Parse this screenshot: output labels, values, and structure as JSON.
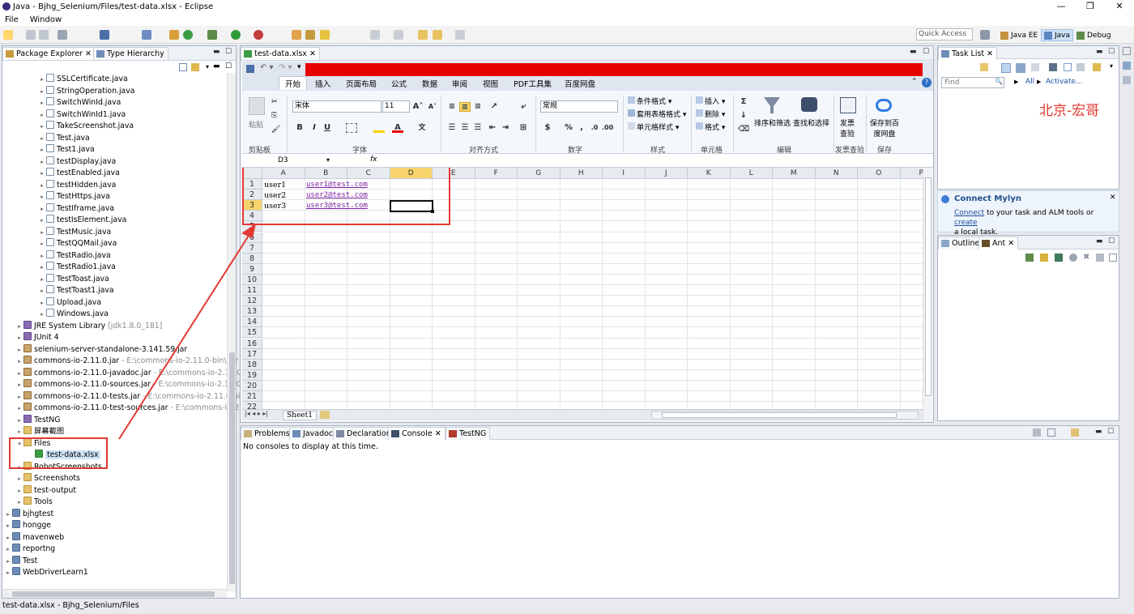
{
  "window": {
    "title": "Java - Bjhg_Selenium/Files/test-data.xlsx - Eclipse",
    "controls": [
      "—",
      "❐",
      "✕"
    ]
  },
  "menu": [
    "File",
    "Window"
  ],
  "toolbar": {
    "quick_access": "Quick Access",
    "perspectives": [
      "Java EE",
      "Java",
      "Debug"
    ]
  },
  "package_explorer": {
    "tabs": [
      "Package Explorer",
      "Type Hierarchy"
    ],
    "java_files": [
      "SSLCertificate.java",
      "StringOperation.java",
      "SwitchWinId.java",
      "SwitchWinId1.java",
      "TakeScreenshot.java",
      "Test.java",
      "Test1.java",
      "testDisplay.java",
      "testEnabled.java",
      "testHidden.java",
      "TestHttps.java",
      "TestIframe.java",
      "testIsElement.java",
      "TestMusic.java",
      "TestQQMail.java",
      "TestRadio.java",
      "TestRadio1.java",
      "TestToast.java",
      "TestToast1.java",
      "Upload.java",
      "Windows.java"
    ],
    "libs": [
      {
        "name": "JRE System Library",
        "extra": "[jdk1.8.0_181]"
      },
      {
        "name": "JUnit 4",
        "extra": ""
      },
      {
        "name": "selenium-server-standalone-3.141.59.jar",
        "extra": ""
      },
      {
        "name": "commons-io-2.11.0.jar",
        "extra": "- E:\\commons-io-2.11.0-bin\\cor"
      },
      {
        "name": "commons-io-2.11.0-javadoc.jar",
        "extra": "- E:\\commons-io-2.11.0"
      },
      {
        "name": "commons-io-2.11.0-sources.jar",
        "extra": "- E:\\commons-io-2.11.0"
      },
      {
        "name": "commons-io-2.11.0-tests.jar",
        "extra": "- E:\\commons-io-2.11.0-bi"
      },
      {
        "name": "commons-io-2.11.0-test-sources.jar",
        "extra": "- E:\\commons-io-2"
      },
      {
        "name": "TestNG",
        "extra": ""
      }
    ],
    "folders": [
      "屏幕截图",
      "Files",
      "test-data.xlsx",
      "RobotScreenshots",
      "Screenshots",
      "test-output",
      "Tools"
    ],
    "projects": [
      "bjhgtest",
      "hongge",
      "mavenweb",
      "reportng",
      "Test",
      "WebDriverLearn1"
    ]
  },
  "editor": {
    "tab": "test-data.xlsx",
    "ribbon_tabs": [
      "开始",
      "插入",
      "页面布局",
      "公式",
      "数据",
      "审阅",
      "视图",
      "PDF工具集",
      "百度网盘"
    ],
    "font_name": "宋体",
    "font_size": "11",
    "number_format": "常规",
    "paste_label": "粘贴",
    "bold": "B",
    "italic": "I",
    "underline": "U",
    "cond_format": "条件格式",
    "table_format": "套用表格格式",
    "cell_style": "单元格样式",
    "insert": "插入",
    "delete": "删除",
    "format": "格式",
    "sort_filter": "排序和筛选",
    "find_select": "查找和选择",
    "invoice_check": "发票\n查验",
    "save_baidu": "保存到百\n度网盘",
    "groups": [
      "剪贴板",
      "字体",
      "对齐方式",
      "数字",
      "样式",
      "单元格",
      "编辑",
      "发票查验",
      "保存"
    ],
    "name_box": "D3",
    "fx": "fx",
    "columns": [
      "A",
      "B",
      "C",
      "D",
      "E",
      "F",
      "G",
      "H",
      "I",
      "J",
      "K",
      "L",
      "M",
      "N",
      "O",
      "P"
    ],
    "rows": [
      "1",
      "2",
      "3",
      "4",
      "5",
      "6",
      "7",
      "8",
      "9",
      "10",
      "11",
      "12",
      "13",
      "14",
      "15",
      "16",
      "17",
      "18",
      "19",
      "20",
      "21",
      "22"
    ],
    "cells": [
      {
        "user": "user1",
        "email": "user1@test.com"
      },
      {
        "user": "user2",
        "email": "user2@test.com"
      },
      {
        "user": "user3",
        "email": "user3@test.com"
      }
    ],
    "sheet": "Sheet1"
  },
  "task_list": {
    "title": "Task List",
    "find_placeholder": "Find",
    "all": "All",
    "activate": "Activate...",
    "watermark": "北京-宏哥"
  },
  "mylyn": {
    "title": "Connect Mylyn",
    "connect": "Connect",
    "text1": " to your task and ALM tools or ",
    "create": "create",
    "text2": "a local task."
  },
  "outline": {
    "tabs": [
      "Outline",
      "Ant"
    ]
  },
  "console": {
    "tabs": [
      "Problems",
      "Javadoc",
      "Declaration",
      "Console",
      "TestNG"
    ],
    "message": "No consoles to display at this time."
  },
  "status": "test-data.xlsx - Bjhg_Selenium/Files",
  "colors": {
    "accent_red": "#e60000",
    "annotation": "#e53935",
    "link": "#7a1fa2"
  }
}
